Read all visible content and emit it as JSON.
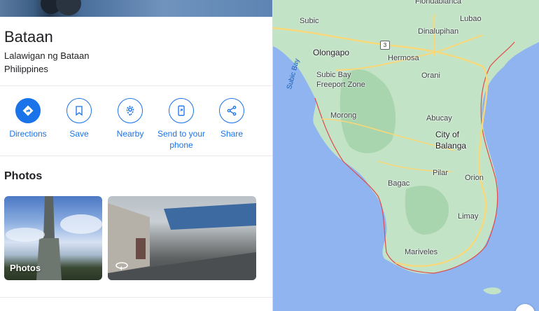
{
  "place": {
    "name": "Bataan",
    "region": "Lalawigan ng Bataan",
    "country": "Philippines"
  },
  "actions": [
    {
      "label": "Directions",
      "icon": "directions-icon"
    },
    {
      "label": "Save",
      "icon": "bookmark-icon"
    },
    {
      "label": "Nearby",
      "icon": "nearby-icon"
    },
    {
      "label": "Send to your phone",
      "icon": "send-to-phone-icon"
    },
    {
      "label": "Share",
      "icon": "share-icon"
    }
  ],
  "photos": {
    "title": "Photos",
    "items": [
      {
        "label": "Photos"
      },
      {
        "label": "",
        "icon": "360-view-icon"
      }
    ]
  },
  "map": {
    "labels": {
      "floridablanca": "Floridablanca",
      "subic": "Subic",
      "lubao": "Lubao",
      "dinalupihan": "Dinalupihan",
      "olongapo": "Olongapo",
      "hermosa": "Hermosa",
      "subic_bay_freeport": "Subic Bay Freeport Zone",
      "subic_bay_water": "Subic Bay",
      "orani": "Orani",
      "morong": "Morong",
      "abucay": "Abucay",
      "city_of_balanga": "City of Balanga",
      "pilar": "Pilar",
      "orion": "Orion",
      "bagac": "Bagac",
      "limay": "Limay",
      "mariveles": "Mariveles"
    },
    "road_shield": "3",
    "colors": {
      "water": "#8fb4f0",
      "land": "#c3e3c7",
      "forest": "#a8d5ad",
      "road": "#f8d878",
      "boundary": "#e04b4b",
      "accent": "#1a73e8"
    }
  }
}
